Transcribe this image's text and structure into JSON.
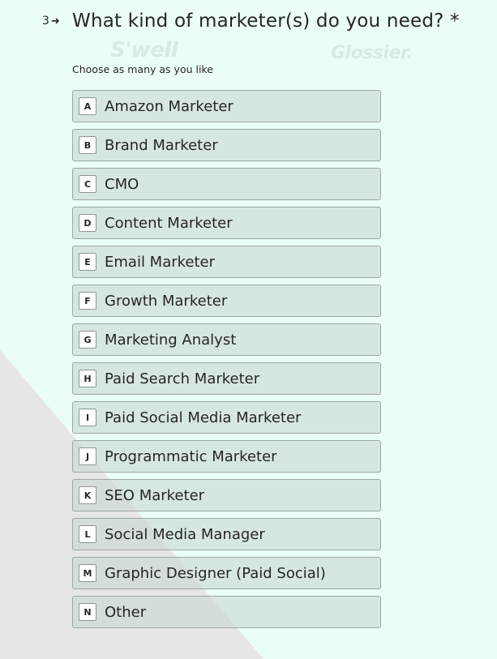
{
  "question": {
    "number": "3",
    "arrow": "➜",
    "title": "What kind of marketer(s) do you need? *",
    "hint": "Choose as many as you like"
  },
  "logos": [
    "S'well",
    "Glossier."
  ],
  "options": [
    {
      "key": "A",
      "label": "Amazon Marketer"
    },
    {
      "key": "B",
      "label": "Brand Marketer"
    },
    {
      "key": "C",
      "label": "CMO"
    },
    {
      "key": "D",
      "label": "Content Marketer"
    },
    {
      "key": "E",
      "label": "Email Marketer"
    },
    {
      "key": "F",
      "label": "Growth Marketer"
    },
    {
      "key": "G",
      "label": "Marketing Analyst"
    },
    {
      "key": "H",
      "label": "Paid Search Marketer"
    },
    {
      "key": "I",
      "label": "Paid Social Media Marketer"
    },
    {
      "key": "J",
      "label": "Programmatic Marketer"
    },
    {
      "key": "K",
      "label": "SEO Marketer"
    },
    {
      "key": "L",
      "label": "Social Media Manager"
    },
    {
      "key": "M",
      "label": "Graphic Designer (Paid Social)"
    },
    {
      "key": "N",
      "label": "Other"
    }
  ],
  "colors": {
    "background": "#eafdf6",
    "option_fill": "#c4d6cd",
    "option_border": "#9fa7a3",
    "text": "#262626"
  }
}
